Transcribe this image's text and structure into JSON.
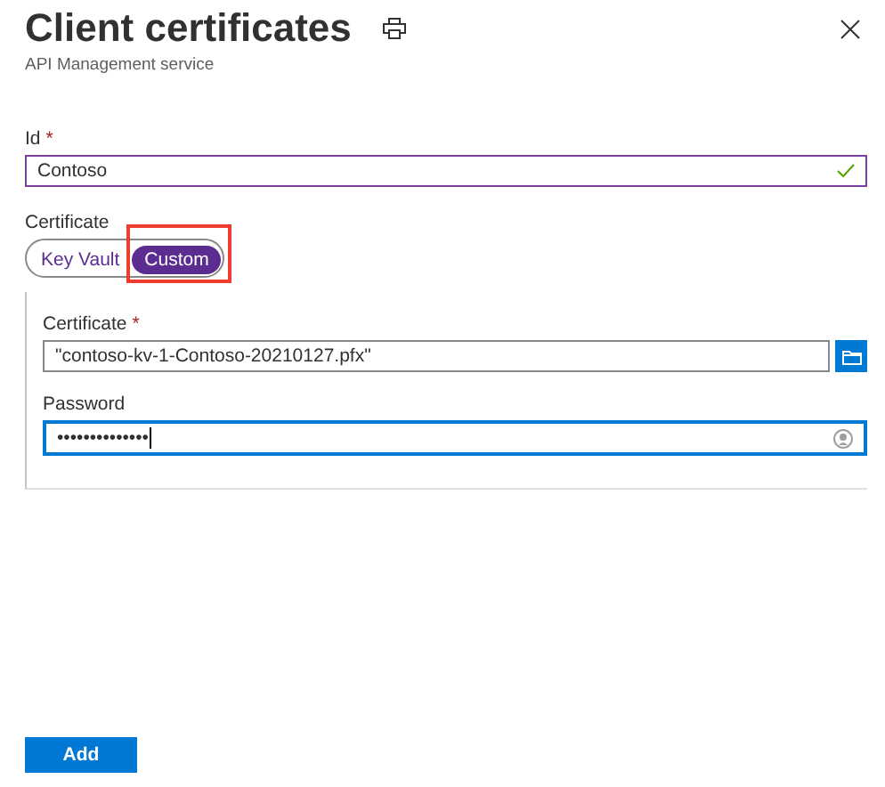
{
  "header": {
    "title": "Client certificates",
    "subtitle": "API Management service"
  },
  "id_field": {
    "label": "Id",
    "required": "*",
    "value": "Contoso",
    "valid": true
  },
  "certificate_source": {
    "label": "Certificate",
    "options": [
      {
        "label": "Key Vault",
        "selected": false,
        "highlighted": false
      },
      {
        "label": "Custom",
        "selected": true,
        "highlighted": true
      }
    ]
  },
  "custom_panel": {
    "certificate": {
      "label": "Certificate",
      "required": "*",
      "value": "\"contoso-kv-1-Contoso-20210127.pfx\""
    },
    "password": {
      "label": "Password",
      "value": "••••••••••••••",
      "focused": true
    }
  },
  "buttons": [
    {
      "label": "Add"
    }
  ]
}
